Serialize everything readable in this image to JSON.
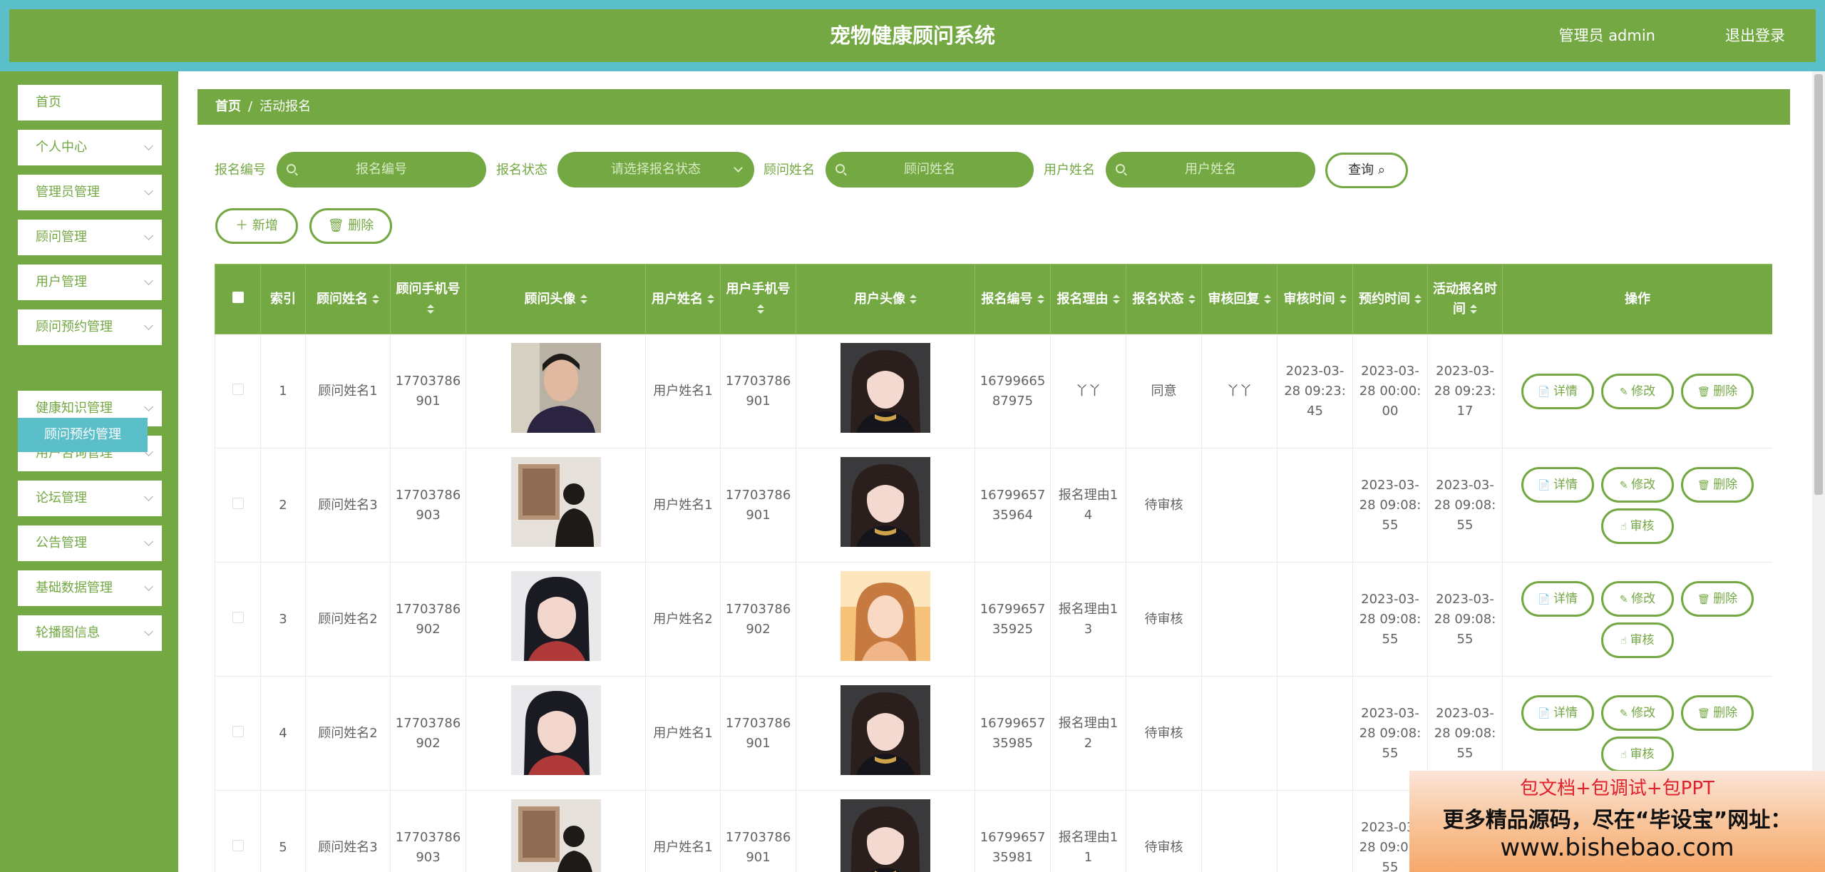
{
  "header": {
    "title": "宠物健康顾问系统",
    "user": "管理员 admin",
    "logout": "退出登录"
  },
  "sidebar": {
    "items": [
      {
        "label": "首页",
        "chevron": false
      },
      {
        "label": "个人中心",
        "chevron": true
      },
      {
        "label": "管理员管理",
        "chevron": true
      },
      {
        "label": "顾问管理",
        "chevron": true
      },
      {
        "label": "用户管理",
        "chevron": true
      },
      {
        "label": "顾问预约管理",
        "chevron": true
      },
      {
        "label": "健康知识管理",
        "chevron": true
      },
      {
        "label": "用户咨询管理",
        "chevron": true
      },
      {
        "label": "论坛管理",
        "chevron": true
      },
      {
        "label": "公告管理",
        "chevron": true
      },
      {
        "label": "基础数据管理",
        "chevron": true
      },
      {
        "label": "轮播图信息",
        "chevron": true
      }
    ],
    "submenu": "顾问预约管理"
  },
  "breadcrumb": {
    "home": "首页",
    "sep": "/",
    "current": "活动报名"
  },
  "filters": {
    "f1_label": "报名编号",
    "f1_placeholder": "报名编号",
    "f2_label": "报名状态",
    "f2_placeholder": "请选择报名状态",
    "f3_label": "顾问姓名",
    "f3_placeholder": "顾问姓名",
    "f4_label": "用户姓名",
    "f4_placeholder": "用户姓名",
    "query": "查询"
  },
  "toolbar": {
    "add": "新增",
    "delete": "删除"
  },
  "table": {
    "headers": [
      "索引",
      "顾问姓名",
      "顾问手机号",
      "顾问头像",
      "用户姓名",
      "用户手机号",
      "用户头像",
      "报名编号",
      "报名理由",
      "报名状态",
      "审核回复",
      "审核时间",
      "预约时间",
      "活动报名时间",
      "操作"
    ],
    "rows": [
      {
        "index": "1",
        "consultant": "顾问姓名1",
        "c_phone": "17703786901",
        "user": "用户姓名1",
        "u_phone": "17703786901",
        "code": "1679966587975",
        "reason": "丫丫",
        "status": "同意",
        "reply": "丫丫",
        "audit_time": "2023-03-28 09:23:45",
        "appt_time": "2023-03-28 00:00:00",
        "signup_time": "2023-03-28 09:23:17",
        "audit": false
      },
      {
        "index": "2",
        "consultant": "顾问姓名3",
        "c_phone": "17703786903",
        "user": "用户姓名1",
        "u_phone": "17703786901",
        "code": "1679965735964",
        "reason": "报名理由14",
        "status": "待审核",
        "reply": "",
        "audit_time": "",
        "appt_time": "2023-03-28 09:08:55",
        "signup_time": "2023-03-28 09:08:55",
        "audit": true
      },
      {
        "index": "3",
        "consultant": "顾问姓名2",
        "c_phone": "17703786902",
        "user": "用户姓名2",
        "u_phone": "17703786902",
        "code": "1679965735925",
        "reason": "报名理由13",
        "status": "待审核",
        "reply": "",
        "audit_time": "",
        "appt_time": "2023-03-28 09:08:55",
        "signup_time": "2023-03-28 09:08:55",
        "audit": true
      },
      {
        "index": "4",
        "consultant": "顾问姓名2",
        "c_phone": "17703786902",
        "user": "用户姓名1",
        "u_phone": "17703786901",
        "code": "1679965735985",
        "reason": "报名理由12",
        "status": "待审核",
        "reply": "",
        "audit_time": "",
        "appt_time": "2023-03-28 09:08:55",
        "signup_time": "2023-03-28 09:08:55",
        "audit": true
      },
      {
        "index": "5",
        "consultant": "顾问姓名3",
        "c_phone": "17703786903",
        "user": "用户姓名1",
        "u_phone": "17703786901",
        "code": "1679965735981",
        "reason": "报名理由11",
        "status": "待审核",
        "reply": "",
        "audit_time": "",
        "appt_time": "2023-03-28 09:08:55",
        "signup_time": "2023-03-28 09:08:55",
        "audit": true
      }
    ],
    "actions": {
      "detail": "详情",
      "edit": "修改",
      "delete": "删除",
      "audit": "审核"
    }
  },
  "watermark": {
    "line1": "包文档+包调试+包PPT",
    "line2": "更多精品源码，尽在“毕设宝”网址：",
    "line3": "www.bishebao.com"
  },
  "colors": {
    "primary": "#73a843",
    "accent": "#5bbfc9"
  }
}
